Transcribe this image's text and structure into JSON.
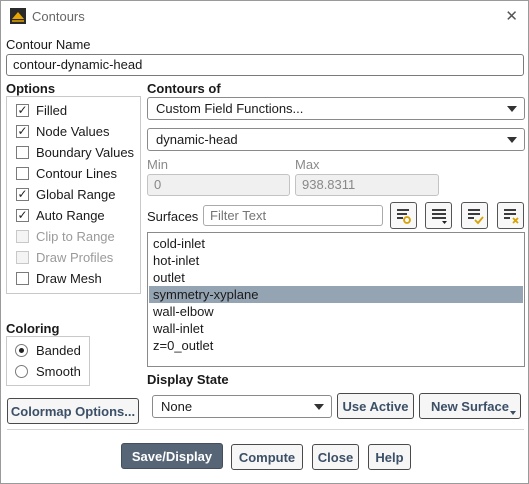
{
  "window": {
    "title": "Contours",
    "close_glyph": "✕"
  },
  "contour_name": {
    "label": "Contour Name",
    "value": "contour-dynamic-head"
  },
  "options": {
    "label": "Options",
    "items": [
      {
        "label": "Filled",
        "checked": true,
        "enabled": true
      },
      {
        "label": "Node Values",
        "checked": true,
        "enabled": true
      },
      {
        "label": "Boundary Values",
        "checked": false,
        "enabled": true
      },
      {
        "label": "Contour Lines",
        "checked": false,
        "enabled": true
      },
      {
        "label": "Global Range",
        "checked": true,
        "enabled": true
      },
      {
        "label": "Auto Range",
        "checked": true,
        "enabled": true
      },
      {
        "label": "Clip to Range",
        "checked": false,
        "enabled": false
      },
      {
        "label": "Draw Profiles",
        "checked": false,
        "enabled": false
      },
      {
        "label": "Draw Mesh",
        "checked": false,
        "enabled": true
      }
    ]
  },
  "coloring": {
    "label": "Coloring",
    "options": [
      {
        "label": "Banded",
        "selected": true
      },
      {
        "label": "Smooth",
        "selected": false
      }
    ]
  },
  "contours_of": {
    "label": "Contours of",
    "category": "Custom Field Functions...",
    "field": "dynamic-head"
  },
  "range": {
    "min_label": "Min",
    "min_value": "0",
    "max_label": "Max",
    "max_value": "938.8311"
  },
  "surfaces": {
    "label": "Surfaces",
    "filter_placeholder": "Filter Text",
    "items": [
      {
        "label": "cold-inlet",
        "selected": false
      },
      {
        "label": "hot-inlet",
        "selected": false
      },
      {
        "label": "outlet",
        "selected": false
      },
      {
        "label": "symmetry-xyplane",
        "selected": true
      },
      {
        "label": "wall-elbow",
        "selected": false
      },
      {
        "label": "wall-inlet",
        "selected": false
      },
      {
        "label": "z=0_outlet",
        "selected": false
      }
    ]
  },
  "display_state": {
    "label": "Display State",
    "value": "None",
    "use_active": "Use Active",
    "new_surface": "New Surface"
  },
  "colormap_button": "Colormap Options...",
  "footer": {
    "save_display": "Save/Display",
    "compute": "Compute",
    "close": "Close",
    "help": "Help"
  },
  "colors": {
    "selected_row": "#95a4b3",
    "primary_button": "#566677",
    "accent_icon": "#d9a200"
  }
}
